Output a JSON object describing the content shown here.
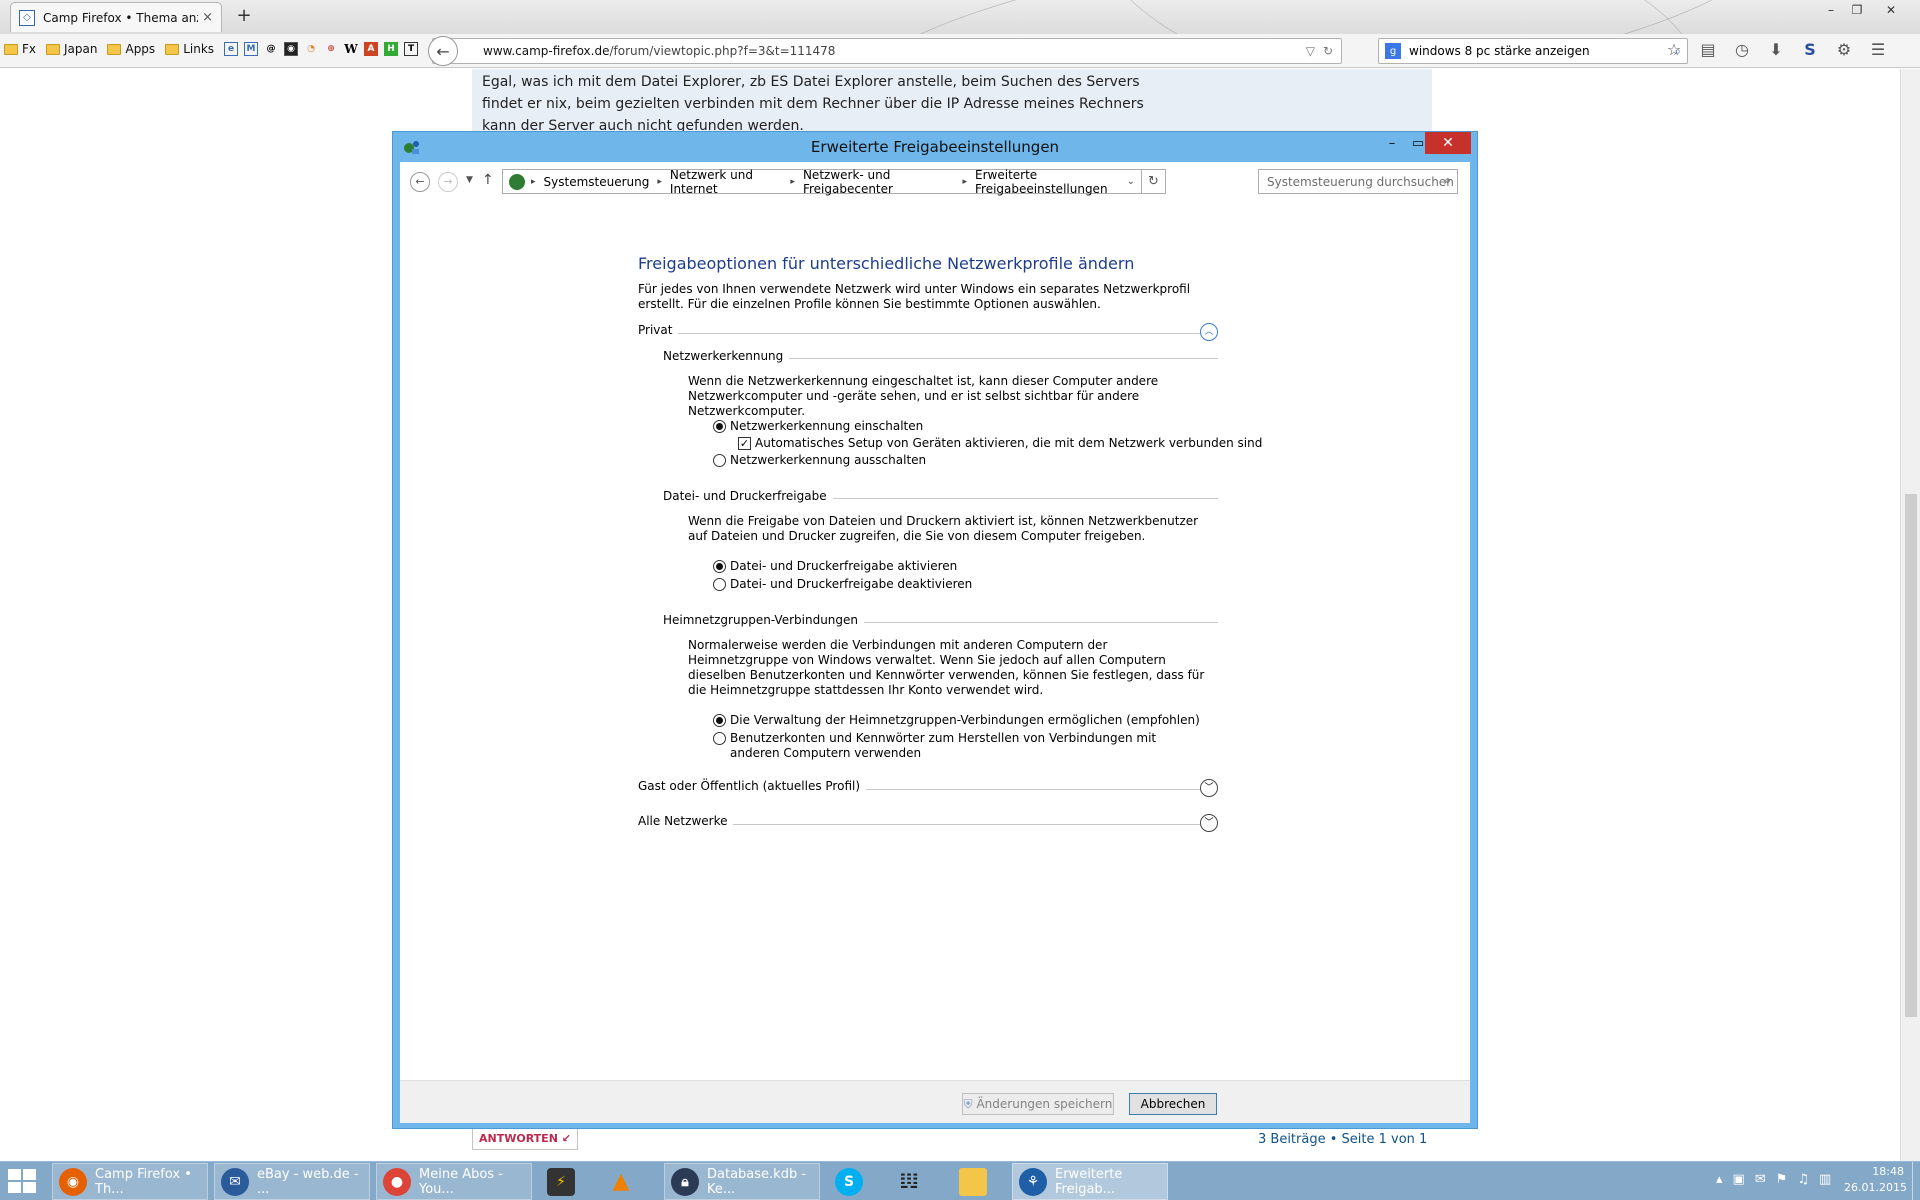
{
  "browser": {
    "tab": {
      "title": "Camp Firefox • Thema anz...",
      "close": "×"
    },
    "new_tab": "+",
    "bookmarks": [
      "Fx",
      "Japan",
      "Apps",
      "Links"
    ],
    "bookmark_icons": [
      "W",
      "A"
    ],
    "url_host": "www.camp-firefox.de",
    "url_path": "/forum/viewtopic.php?f=3&t=111478",
    "search_value": "windows 8 pc stärke anzeigen"
  },
  "page": {
    "post_text": "Egal, was ich mit dem Datei Explorer, zb ES Datei Explorer anstelle, beim Suchen des Servers findet er nix, beim gezielten verbinden mit dem Rechner über die IP Adresse meines Rechners kann der Server auch nicht gefunden werden.",
    "reply_button": "ANTWORTEN",
    "page_info": "3 Beiträge • Seite 1 von 1"
  },
  "dialog": {
    "title": "Erweiterte Freigabeeinstellungen",
    "breadcrumb": [
      "Systemsteuerung",
      "Netzwerk und Internet",
      "Netzwerk- und Freigabecenter",
      "Erweiterte Freigabeeinstellungen"
    ],
    "search_placeholder": "Systemsteuerung durchsuchen",
    "heading": "Freigabeoptionen für unterschiedliche Netzwerkprofile ändern",
    "intro": "Für jedes von Ihnen verwendete Netzwerk wird unter Windows ein separates Netzwerkprofil erstellt. Für die einzelnen Profile können Sie bestimmte Optionen auswählen.",
    "profiles": {
      "private": "Privat",
      "guest": "Gast oder Öffentlich (aktuelles Profil)",
      "all": "Alle Netzwerke"
    },
    "network_discovery": {
      "title": "Netzwerkerkennung",
      "desc": "Wenn die Netzwerkerkennung eingeschaltet ist, kann dieser Computer andere Netzwerkcomputer und -geräte sehen, und er ist selbst sichtbar für andere Netzwerkcomputer.",
      "on": "Netzwerkerkennung einschalten",
      "auto_setup": "Automatisches Setup von Geräten aktivieren, die mit dem Netzwerk verbunden sind",
      "off": "Netzwerkerkennung ausschalten"
    },
    "file_sharing": {
      "title": "Datei- und Druckerfreigabe",
      "desc": "Wenn die Freigabe von Dateien und Druckern aktiviert ist, können Netzwerkbenutzer auf Dateien und Drucker zugreifen, die Sie von diesem Computer freigeben.",
      "on": "Datei- und Druckerfreigabe aktivieren",
      "off": "Datei- und Druckerfreigabe deaktivieren"
    },
    "homegroup": {
      "title": "Heimnetzgruppen-Verbindungen",
      "desc": "Normalerweise werden die Verbindungen mit anderen Computern der Heimnetzgruppe von Windows verwaltet. Wenn Sie jedoch auf allen Computern dieselben Benutzerkonten und Kennwörter verwenden, können Sie festlegen, dass für die Heimnetzgruppe stattdessen Ihr Konto verwendet wird.",
      "opt1": "Die Verwaltung der Heimnetzgruppen-Verbindungen ermöglichen (empfohlen)",
      "opt2": "Benutzerkonten und Kennwörter zum Herstellen von Verbindungen mit anderen Computern verwenden"
    },
    "save_button": "Änderungen speichern",
    "cancel_button": "Abbrechen"
  },
  "taskbar": {
    "tasks": [
      "Camp Firefox • Th...",
      "eBay - web.de - ...",
      "Meine Abos - You...",
      "Database.kdb - Ke...",
      "Erweiterte Freigab..."
    ],
    "time": "18:48",
    "date": "26.01.2015"
  }
}
